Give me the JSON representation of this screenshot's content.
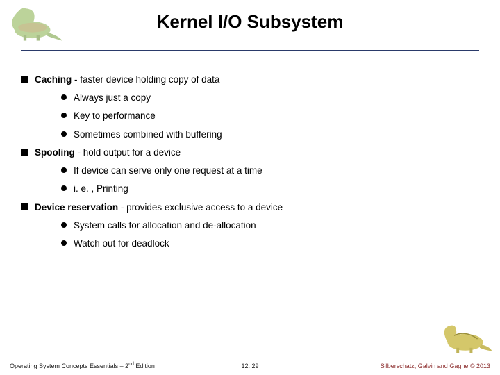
{
  "title": "Kernel I/O Subsystem",
  "bullets": [
    {
      "bold": "Caching",
      "rest": " - faster device holding copy of data",
      "sub": [
        "Always just a copy",
        "Key to performance",
        "Sometimes combined with buffering"
      ]
    },
    {
      "bold": "Spooling",
      "rest": " - hold output for a device",
      "sub": [
        "If device can serve only one request at a time",
        "i. e. , Printing"
      ]
    },
    {
      "bold": "Device reservation",
      "rest": " - provides exclusive access to a device",
      "sub": [
        "System calls for allocation and de-allocation",
        "Watch out for deadlock"
      ]
    }
  ],
  "footer": {
    "left_prefix": "Operating System Concepts Essentials  – 2",
    "left_sup": "nd",
    "left_suffix": " Edition",
    "center": "12. 29",
    "right": "Silberschatz, Galvin and Gagne © 2013"
  },
  "icons": {
    "top_dino": "dinosaur-top-icon",
    "bottom_dino": "dinosaur-bottom-icon"
  }
}
